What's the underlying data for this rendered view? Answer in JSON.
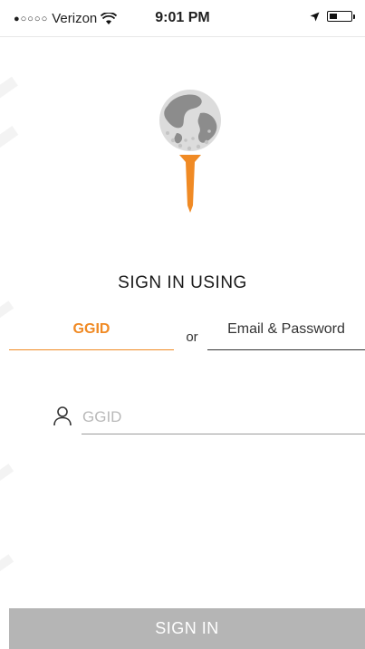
{
  "status_bar": {
    "carrier": "Verizon",
    "signal_dots": "●○○○○",
    "time": "9:01 PM",
    "icons": [
      "wifi-icon",
      "location-arrow-icon",
      "battery-icon"
    ]
  },
  "logo": {
    "icon": "globe-golf-ball-on-tee-icon"
  },
  "heading": "SIGN IN USING",
  "tabs": {
    "ggid_label": "GGID",
    "separator": "or",
    "email_label": "Email & Password",
    "active": "GGID"
  },
  "form": {
    "ggid_placeholder": "GGID",
    "ggid_value": "",
    "user_icon": "user-icon"
  },
  "signin_label": "SIGN IN",
  "colors": {
    "accent": "#f08a24",
    "button_disabled": "#b5b5b5",
    "globe": "#8c8c8c"
  }
}
